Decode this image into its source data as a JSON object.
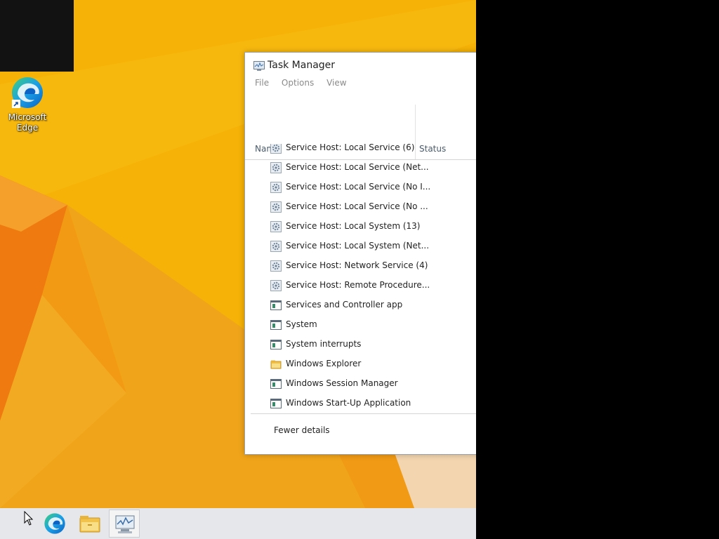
{
  "desktop": {
    "icons": [
      {
        "label": "Microsoft Edge",
        "icon": "edge-icon"
      }
    ],
    "colors": {
      "wallpaper": "#f6b206",
      "accent_orange": "#ee7a10"
    }
  },
  "task_manager": {
    "title": "Task Manager",
    "menu": [
      "File",
      "Options",
      "View"
    ],
    "columns": {
      "name": "Name",
      "status": "Status"
    },
    "processes": [
      {
        "name": "Service Host: Local Service (6)",
        "icon": "gear-icon"
      },
      {
        "name": "Service Host: Local Service (Net...",
        "icon": "gear-icon"
      },
      {
        "name": "Service Host: Local Service (No I...",
        "icon": "gear-icon"
      },
      {
        "name": "Service Host: Local Service (No ...",
        "icon": "gear-icon"
      },
      {
        "name": "Service Host: Local System (13)",
        "icon": "gear-icon"
      },
      {
        "name": "Service Host: Local System (Net...",
        "icon": "gear-icon"
      },
      {
        "name": "Service Host: Network Service (4)",
        "icon": "gear-icon"
      },
      {
        "name": "Service Host: Remote Procedure...",
        "icon": "gear-icon"
      },
      {
        "name": "Services and Controller app",
        "icon": "window-icon"
      },
      {
        "name": "System",
        "icon": "window-icon"
      },
      {
        "name": "System interrupts",
        "icon": "window-icon"
      },
      {
        "name": "Windows Explorer",
        "icon": "folder-icon"
      },
      {
        "name": "Windows Session Manager",
        "icon": "window-icon"
      },
      {
        "name": "Windows Start-Up Application",
        "icon": "window-icon"
      }
    ],
    "footer": {
      "fewer_details": "Fewer details"
    }
  },
  "taskbar": {
    "items": [
      {
        "icon": "edge-icon",
        "active": false
      },
      {
        "icon": "file-explorer-icon",
        "active": false
      },
      {
        "icon": "task-manager-icon",
        "active": true
      }
    ]
  }
}
